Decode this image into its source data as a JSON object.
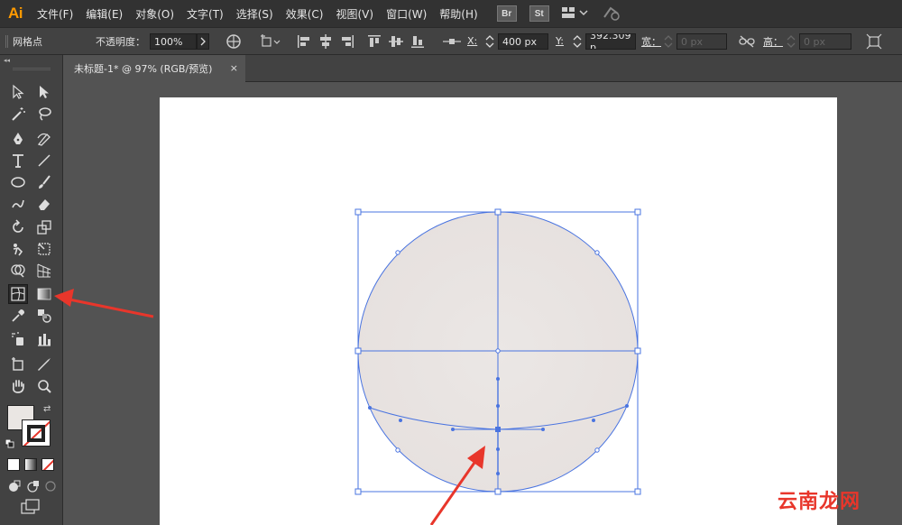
{
  "app": {
    "logo": "Ai"
  },
  "menu": {
    "items": [
      "文件(F)",
      "编辑(E)",
      "对象(O)",
      "文字(T)",
      "选择(S)",
      "效果(C)",
      "视图(V)",
      "窗口(W)",
      "帮助(H)"
    ],
    "apps": [
      "Br",
      "St"
    ]
  },
  "control_bar": {
    "object_type": "网格点",
    "opacity_label": "不透明度：",
    "opacity_value": "100%",
    "x_label": "X:",
    "x_value": "400 px",
    "y_label": "Y:",
    "y_value": "392.309 p",
    "width_label": "宽：",
    "width_value": "0 px",
    "height_label": "高：",
    "height_value": "0 px"
  },
  "document_tab": {
    "title": "未标题-1* @ 97% (RGB/预览)",
    "close": "×"
  },
  "toolbox": {
    "collapse": "◂◂",
    "tools": [
      "selection-tool",
      "direct-selection-tool",
      "magic-wand-tool",
      "lasso-tool",
      "pen-tool",
      "curvature-tool",
      "type-tool",
      "line-segment-tool",
      "ellipse-tool",
      "paintbrush-tool",
      "shaper-tool",
      "eraser-tool",
      "rotate-tool",
      "scale-tool",
      "puppet-warp-tool",
      "free-transform-tool",
      "shape-builder-tool",
      "perspective-grid-tool",
      "mesh-tool",
      "gradient-tool",
      "eyedropper-tool",
      "blend-tool",
      "symbol-sprayer-tool",
      "column-graph-tool",
      "artboard-tool",
      "slice-tool",
      "hand-tool",
      "zoom-tool"
    ],
    "selected_tool": "mesh-tool",
    "fill_color": "#eae6e3"
  },
  "canvas": {
    "artboard_color": "#ffffff",
    "shape_fill": "#e9e4e2",
    "path_color": "#4a74e0",
    "arrow_color": "#e8362b"
  },
  "watermark": "云南龙网"
}
